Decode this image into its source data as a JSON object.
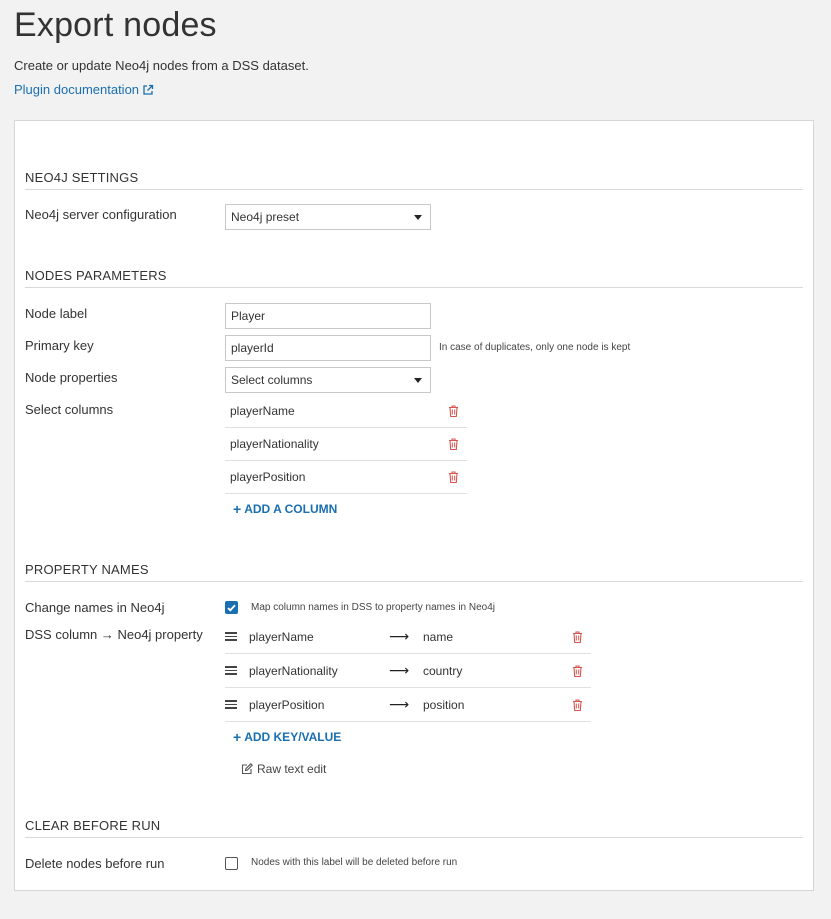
{
  "page": {
    "title": "Export nodes",
    "description": "Create or update Neo4j nodes from a DSS dataset.",
    "doc_link": "Plugin documentation"
  },
  "sections": {
    "neo4j_settings": {
      "header": "NEO4J SETTINGS",
      "server_config_label": "Neo4j server configuration",
      "server_config_value": "Neo4j preset"
    },
    "nodes_parameters": {
      "header": "NODES PARAMETERS",
      "node_label_label": "Node label",
      "node_label_value": "Player",
      "primary_key_label": "Primary key",
      "primary_key_value": "playerId",
      "primary_key_hint": "In case of duplicates, only one node is kept",
      "node_properties_label": "Node properties",
      "node_properties_value": "Select columns",
      "select_columns_label": "Select columns",
      "columns": [
        "playerName",
        "playerNationality",
        "playerPosition"
      ],
      "add_column": "ADD A COLUMN"
    },
    "property_names": {
      "header": "PROPERTY NAMES",
      "change_names_label": "Change names in Neo4j",
      "change_names_checked": true,
      "change_names_hint": "Map column names in DSS to property names in Neo4j",
      "mapping_label": "DSS column → Neo4j property",
      "mappings": [
        {
          "key": "playerName",
          "arrow": "⟶",
          "value": "name"
        },
        {
          "key": "playerNationality",
          "arrow": "⟶",
          "value": "country"
        },
        {
          "key": "playerPosition",
          "arrow": "⟶",
          "value": "position"
        }
      ],
      "add_key_value": "ADD KEY/VALUE",
      "raw_text_edit": "Raw text edit"
    },
    "clear_before_run": {
      "header": "CLEAR BEFORE RUN",
      "delete_label": "Delete nodes before run",
      "delete_checked": false,
      "delete_hint": "Nodes with this label will be deleted before run"
    }
  },
  "colors": {
    "accent": "#1a6fb0",
    "trash": "#d9534f"
  }
}
